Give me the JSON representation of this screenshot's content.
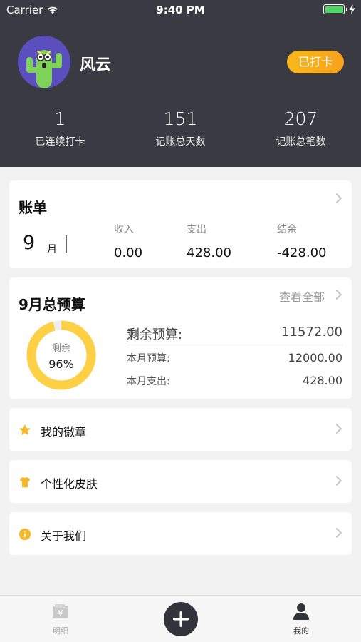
{
  "status_bar": {
    "carrier": "Carrier",
    "time": "9:40 PM"
  },
  "profile": {
    "username": "风云",
    "checkin_label": "已打卡",
    "stats": [
      {
        "value": "1",
        "label": "已连续打卡"
      },
      {
        "value": "151",
        "label": "记账总天数"
      },
      {
        "value": "207",
        "label": "记账总笔数"
      }
    ]
  },
  "bill": {
    "title": "账单",
    "month": "9",
    "month_unit": "月",
    "income_label": "收入",
    "income_value": "0.00",
    "expense_label": "支出",
    "expense_value": "428.00",
    "balance_label": "结余",
    "balance_value": "-428.00"
  },
  "budget": {
    "title": "9月总预算",
    "view_all": "查看全部",
    "remaining_label": "剩余",
    "remaining_percent": "96%",
    "remaining_fraction": 0.96,
    "remaining_budget_label": "剩余预算:",
    "remaining_budget_value": "11572.00",
    "month_budget_label": "本月预算:",
    "month_budget_value": "12000.00",
    "month_expense_label": "本月支出:",
    "month_expense_value": "428.00",
    "ring_color": "#fdd046",
    "ring_track_color": "#eeeeee"
  },
  "menu": [
    {
      "label": "我的徽章",
      "icon": "star-icon"
    },
    {
      "label": "个性化皮肤",
      "icon": "tshirt-icon"
    },
    {
      "label": "关于我们",
      "icon": "info-icon"
    }
  ],
  "tabbar": {
    "details_label": "明细",
    "mine_label": "我的"
  },
  "colors": {
    "header_bg": "#3a3a43",
    "accent": "#f9b81c",
    "icon_yellow": "#f5b72b"
  }
}
